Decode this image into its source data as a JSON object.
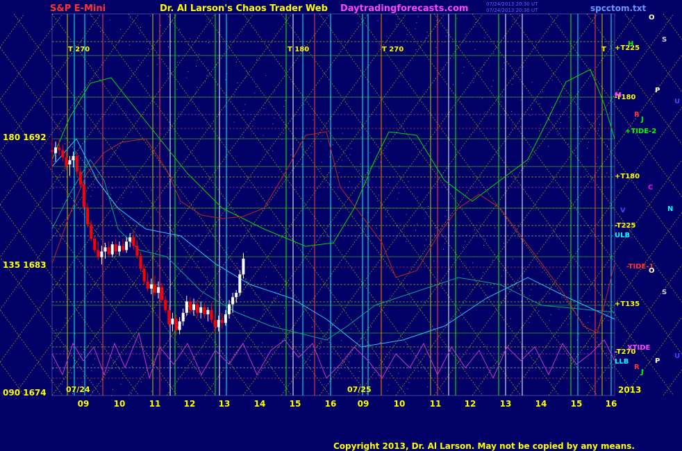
{
  "header": {
    "symbol": "S&P E-Mini",
    "author": "Dr. Al Larson's Chaos Trader Web",
    "site": "Daytradingforecasts.com",
    "stamp1": "07/24/2013 20:30 UT",
    "stamp2": "07/24/2013 20:30 UT",
    "file": "spcctom.txt"
  },
  "copyright": "Copyright 2013, Dr. Al Larson. May not be copied by any means.",
  "year": "2013",
  "colors": {
    "background": "#000066",
    "up_bar": "#ffffff",
    "down_bar": "#ff0000",
    "axis_text": "#ffff00"
  },
  "chart_data": {
    "type": "candlestick",
    "ylim": [
      1674,
      1696
    ],
    "y_ticks": [
      {
        "price": 1692,
        "label": "180  1692"
      },
      {
        "price": 1683,
        "label": "135  1683"
      },
      {
        "price": 1674,
        "label": "090  1674"
      }
    ],
    "x_ticks": [
      "09",
      "10",
      "11",
      "12",
      "13",
      "14",
      "15",
      "16",
      "09",
      "10",
      "11",
      "12",
      "13",
      "14",
      "15",
      "16"
    ],
    "date_labels": [
      "07/24",
      "07/25"
    ],
    "time_markers": [
      "T  270",
      "T  180",
      "T  270",
      "T"
    ],
    "right_labels": [
      {
        "text": "+T225",
        "color": "#ffff00"
      },
      {
        "text": "-T180",
        "color": "#ffff00"
      },
      {
        "text": "+TIDE-2",
        "color": "#00ff00"
      },
      {
        "text": "+T180",
        "color": "#ffff00"
      },
      {
        "text": "-T225",
        "color": "#ffff00"
      },
      {
        "text": "ULB",
        "color": "#00ffff"
      },
      {
        "text": "-TIDE-1",
        "color": "#ff3333"
      },
      {
        "text": "+T135",
        "color": "#ffff00"
      },
      {
        "text": "XTIDE",
        "color": "#ff44ff"
      },
      {
        "text": "-T270",
        "color": "#ffff00"
      },
      {
        "text": "LLB",
        "color": "#00ffff"
      }
    ],
    "planet_labels": [
      {
        "text": "O",
        "color": "#ffffff"
      },
      {
        "text": "S",
        "color": "#cccccc"
      },
      {
        "text": "P",
        "color": "#ffffff"
      },
      {
        "text": "U",
        "color": "#4444ff"
      },
      {
        "text": "R",
        "color": "#ff3333"
      },
      {
        "text": "J",
        "color": "#00ff00"
      },
      {
        "text": "C",
        "color": "#ff00ff"
      },
      {
        "text": "N",
        "color": "#00ffff"
      },
      {
        "text": "V",
        "color": "#4444ff"
      },
      {
        "text": "H",
        "color": "#00ff00"
      },
      {
        "text": "M",
        "color": "#ff44ff"
      }
    ],
    "price_bars": [
      {
        "x": 0.0,
        "o": 1691.0,
        "h": 1691.9,
        "l": 1689.7,
        "c": 1690.9
      },
      {
        "x": 0.1,
        "o": 1690.8,
        "h": 1691.6,
        "l": 1690.2,
        "c": 1691.2
      },
      {
        "x": 0.2,
        "o": 1691.2,
        "h": 1691.8,
        "l": 1690.6,
        "c": 1691.0
      },
      {
        "x": 0.3,
        "o": 1691.0,
        "h": 1691.4,
        "l": 1690.2,
        "c": 1690.5
      },
      {
        "x": 0.4,
        "o": 1690.5,
        "h": 1690.9,
        "l": 1689.6,
        "c": 1689.9
      },
      {
        "x": 0.5,
        "o": 1690.0,
        "h": 1690.6,
        "l": 1689.2,
        "c": 1690.3
      },
      {
        "x": 0.6,
        "o": 1690.3,
        "h": 1690.9,
        "l": 1689.8,
        "c": 1690.6
      },
      {
        "x": 0.7,
        "o": 1690.6,
        "h": 1690.8,
        "l": 1689.2,
        "c": 1689.5
      },
      {
        "x": 0.8,
        "o": 1689.5,
        "h": 1689.8,
        "l": 1688.4,
        "c": 1688.6
      },
      {
        "x": 0.9,
        "o": 1688.6,
        "h": 1688.8,
        "l": 1686.8,
        "c": 1687.0
      },
      {
        "x": 1.0,
        "o": 1687.0,
        "h": 1687.3,
        "l": 1685.6,
        "c": 1685.8
      },
      {
        "x": 1.1,
        "o": 1685.8,
        "h": 1686.1,
        "l": 1684.6,
        "c": 1684.8
      },
      {
        "x": 1.2,
        "o": 1684.8,
        "h": 1685.0,
        "l": 1683.8,
        "c": 1684.0
      },
      {
        "x": 1.3,
        "o": 1684.0,
        "h": 1684.6,
        "l": 1683.3,
        "c": 1683.5
      },
      {
        "x": 1.4,
        "o": 1683.5,
        "h": 1684.3,
        "l": 1683.0,
        "c": 1683.9
      },
      {
        "x": 1.5,
        "o": 1683.9,
        "h": 1684.5,
        "l": 1683.4,
        "c": 1684.2
      },
      {
        "x": 1.6,
        "o": 1684.2,
        "h": 1684.6,
        "l": 1683.5,
        "c": 1683.7
      },
      {
        "x": 1.7,
        "o": 1683.7,
        "h": 1684.6,
        "l": 1683.5,
        "c": 1684.4
      },
      {
        "x": 1.8,
        "o": 1684.4,
        "h": 1684.8,
        "l": 1683.6,
        "c": 1683.9
      },
      {
        "x": 1.9,
        "o": 1683.9,
        "h": 1684.6,
        "l": 1683.6,
        "c": 1684.3
      },
      {
        "x": 2.0,
        "o": 1684.3,
        "h": 1684.8,
        "l": 1683.8,
        "c": 1684.0
      },
      {
        "x": 2.1,
        "o": 1684.0,
        "h": 1684.9,
        "l": 1683.8,
        "c": 1684.6
      },
      {
        "x": 2.2,
        "o": 1684.6,
        "h": 1685.2,
        "l": 1684.2,
        "c": 1684.9
      },
      {
        "x": 2.3,
        "o": 1684.9,
        "h": 1685.3,
        "l": 1684.0,
        "c": 1684.3
      },
      {
        "x": 2.4,
        "o": 1684.3,
        "h": 1684.7,
        "l": 1683.4,
        "c": 1683.6
      },
      {
        "x": 2.5,
        "o": 1683.6,
        "h": 1683.9,
        "l": 1682.5,
        "c": 1682.7
      },
      {
        "x": 2.6,
        "o": 1682.7,
        "h": 1683.0,
        "l": 1681.6,
        "c": 1681.8
      },
      {
        "x": 2.7,
        "o": 1681.8,
        "h": 1682.4,
        "l": 1681.1,
        "c": 1681.3
      },
      {
        "x": 2.8,
        "o": 1681.3,
        "h": 1682.0,
        "l": 1680.9,
        "c": 1681.6
      },
      {
        "x": 2.9,
        "o": 1681.6,
        "h": 1682.2,
        "l": 1680.8,
        "c": 1681.0
      },
      {
        "x": 3.0,
        "o": 1681.0,
        "h": 1681.8,
        "l": 1680.6,
        "c": 1681.4
      },
      {
        "x": 3.1,
        "o": 1681.4,
        "h": 1681.7,
        "l": 1680.3,
        "c": 1680.5
      },
      {
        "x": 3.2,
        "o": 1680.5,
        "h": 1680.8,
        "l": 1679.6,
        "c": 1679.8
      },
      {
        "x": 3.3,
        "o": 1679.8,
        "h": 1680.1,
        "l": 1678.6,
        "c": 1678.8
      },
      {
        "x": 3.4,
        "o": 1678.8,
        "h": 1679.6,
        "l": 1678.3,
        "c": 1679.2
      },
      {
        "x": 3.5,
        "o": 1679.2,
        "h": 1679.5,
        "l": 1678.0,
        "c": 1678.4
      },
      {
        "x": 3.6,
        "o": 1678.4,
        "h": 1679.3,
        "l": 1678.1,
        "c": 1679.0
      },
      {
        "x": 3.7,
        "o": 1679.0,
        "h": 1679.9,
        "l": 1678.7,
        "c": 1679.6
      },
      {
        "x": 3.8,
        "o": 1679.6,
        "h": 1680.8,
        "l": 1679.4,
        "c": 1680.4
      },
      {
        "x": 3.9,
        "o": 1680.4,
        "h": 1680.7,
        "l": 1679.5,
        "c": 1679.8
      },
      {
        "x": 4.0,
        "o": 1679.8,
        "h": 1680.6,
        "l": 1679.4,
        "c": 1680.2
      },
      {
        "x": 4.1,
        "o": 1680.2,
        "h": 1680.5,
        "l": 1679.3,
        "c": 1679.6
      },
      {
        "x": 4.2,
        "o": 1679.6,
        "h": 1680.4,
        "l": 1679.2,
        "c": 1680.0
      },
      {
        "x": 4.3,
        "o": 1680.0,
        "h": 1680.3,
        "l": 1679.2,
        "c": 1679.5
      },
      {
        "x": 4.4,
        "o": 1679.5,
        "h": 1680.0,
        "l": 1679.0,
        "c": 1679.8
      },
      {
        "x": 4.5,
        "o": 1679.8,
        "h": 1680.3,
        "l": 1678.9,
        "c": 1679.1
      },
      {
        "x": 4.6,
        "o": 1679.1,
        "h": 1679.5,
        "l": 1678.1,
        "c": 1678.6
      },
      {
        "x": 4.7,
        "o": 1678.6,
        "h": 1679.4,
        "l": 1678.3,
        "c": 1679.1
      },
      {
        "x": 4.8,
        "o": 1679.1,
        "h": 1679.6,
        "l": 1678.5,
        "c": 1678.9
      },
      {
        "x": 4.9,
        "o": 1678.9,
        "h": 1679.8,
        "l": 1678.7,
        "c": 1679.5
      },
      {
        "x": 5.0,
        "o": 1679.5,
        "h": 1680.5,
        "l": 1679.2,
        "c": 1680.2
      },
      {
        "x": 5.1,
        "o": 1680.2,
        "h": 1681.0,
        "l": 1679.6,
        "c": 1680.7
      },
      {
        "x": 5.2,
        "o": 1680.7,
        "h": 1681.2,
        "l": 1680.3,
        "c": 1681.0
      },
      {
        "x": 5.3,
        "o": 1681.0,
        "h": 1682.6,
        "l": 1680.8,
        "c": 1682.3
      },
      {
        "x": 5.4,
        "o": 1682.3,
        "h": 1683.8,
        "l": 1682.0,
        "c": 1683.4
      }
    ]
  }
}
